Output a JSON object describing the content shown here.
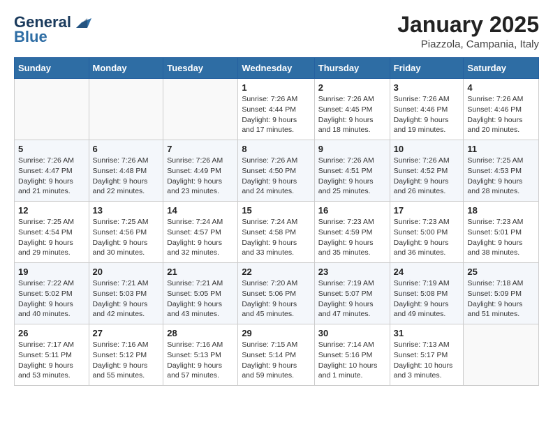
{
  "header": {
    "logo_general": "General",
    "logo_blue": "Blue",
    "title": "January 2025",
    "location": "Piazzola, Campania, Italy"
  },
  "weekdays": [
    "Sunday",
    "Monday",
    "Tuesday",
    "Wednesday",
    "Thursday",
    "Friday",
    "Saturday"
  ],
  "weeks": [
    [
      {
        "day": "",
        "sunrise": "",
        "sunset": "",
        "daylight": ""
      },
      {
        "day": "",
        "sunrise": "",
        "sunset": "",
        "daylight": ""
      },
      {
        "day": "",
        "sunrise": "",
        "sunset": "",
        "daylight": ""
      },
      {
        "day": "1",
        "sunrise": "Sunrise: 7:26 AM",
        "sunset": "Sunset: 4:44 PM",
        "daylight": "Daylight: 9 hours and 17 minutes."
      },
      {
        "day": "2",
        "sunrise": "Sunrise: 7:26 AM",
        "sunset": "Sunset: 4:45 PM",
        "daylight": "Daylight: 9 hours and 18 minutes."
      },
      {
        "day": "3",
        "sunrise": "Sunrise: 7:26 AM",
        "sunset": "Sunset: 4:46 PM",
        "daylight": "Daylight: 9 hours and 19 minutes."
      },
      {
        "day": "4",
        "sunrise": "Sunrise: 7:26 AM",
        "sunset": "Sunset: 4:46 PM",
        "daylight": "Daylight: 9 hours and 20 minutes."
      }
    ],
    [
      {
        "day": "5",
        "sunrise": "Sunrise: 7:26 AM",
        "sunset": "Sunset: 4:47 PM",
        "daylight": "Daylight: 9 hours and 21 minutes."
      },
      {
        "day": "6",
        "sunrise": "Sunrise: 7:26 AM",
        "sunset": "Sunset: 4:48 PM",
        "daylight": "Daylight: 9 hours and 22 minutes."
      },
      {
        "day": "7",
        "sunrise": "Sunrise: 7:26 AM",
        "sunset": "Sunset: 4:49 PM",
        "daylight": "Daylight: 9 hours and 23 minutes."
      },
      {
        "day": "8",
        "sunrise": "Sunrise: 7:26 AM",
        "sunset": "Sunset: 4:50 PM",
        "daylight": "Daylight: 9 hours and 24 minutes."
      },
      {
        "day": "9",
        "sunrise": "Sunrise: 7:26 AM",
        "sunset": "Sunset: 4:51 PM",
        "daylight": "Daylight: 9 hours and 25 minutes."
      },
      {
        "day": "10",
        "sunrise": "Sunrise: 7:26 AM",
        "sunset": "Sunset: 4:52 PM",
        "daylight": "Daylight: 9 hours and 26 minutes."
      },
      {
        "day": "11",
        "sunrise": "Sunrise: 7:25 AM",
        "sunset": "Sunset: 4:53 PM",
        "daylight": "Daylight: 9 hours and 28 minutes."
      }
    ],
    [
      {
        "day": "12",
        "sunrise": "Sunrise: 7:25 AM",
        "sunset": "Sunset: 4:54 PM",
        "daylight": "Daylight: 9 hours and 29 minutes."
      },
      {
        "day": "13",
        "sunrise": "Sunrise: 7:25 AM",
        "sunset": "Sunset: 4:56 PM",
        "daylight": "Daylight: 9 hours and 30 minutes."
      },
      {
        "day": "14",
        "sunrise": "Sunrise: 7:24 AM",
        "sunset": "Sunset: 4:57 PM",
        "daylight": "Daylight: 9 hours and 32 minutes."
      },
      {
        "day": "15",
        "sunrise": "Sunrise: 7:24 AM",
        "sunset": "Sunset: 4:58 PM",
        "daylight": "Daylight: 9 hours and 33 minutes."
      },
      {
        "day": "16",
        "sunrise": "Sunrise: 7:23 AM",
        "sunset": "Sunset: 4:59 PM",
        "daylight": "Daylight: 9 hours and 35 minutes."
      },
      {
        "day": "17",
        "sunrise": "Sunrise: 7:23 AM",
        "sunset": "Sunset: 5:00 PM",
        "daylight": "Daylight: 9 hours and 36 minutes."
      },
      {
        "day": "18",
        "sunrise": "Sunrise: 7:23 AM",
        "sunset": "Sunset: 5:01 PM",
        "daylight": "Daylight: 9 hours and 38 minutes."
      }
    ],
    [
      {
        "day": "19",
        "sunrise": "Sunrise: 7:22 AM",
        "sunset": "Sunset: 5:02 PM",
        "daylight": "Daylight: 9 hours and 40 minutes."
      },
      {
        "day": "20",
        "sunrise": "Sunrise: 7:21 AM",
        "sunset": "Sunset: 5:03 PM",
        "daylight": "Daylight: 9 hours and 42 minutes."
      },
      {
        "day": "21",
        "sunrise": "Sunrise: 7:21 AM",
        "sunset": "Sunset: 5:05 PM",
        "daylight": "Daylight: 9 hours and 43 minutes."
      },
      {
        "day": "22",
        "sunrise": "Sunrise: 7:20 AM",
        "sunset": "Sunset: 5:06 PM",
        "daylight": "Daylight: 9 hours and 45 minutes."
      },
      {
        "day": "23",
        "sunrise": "Sunrise: 7:19 AM",
        "sunset": "Sunset: 5:07 PM",
        "daylight": "Daylight: 9 hours and 47 minutes."
      },
      {
        "day": "24",
        "sunrise": "Sunrise: 7:19 AM",
        "sunset": "Sunset: 5:08 PM",
        "daylight": "Daylight: 9 hours and 49 minutes."
      },
      {
        "day": "25",
        "sunrise": "Sunrise: 7:18 AM",
        "sunset": "Sunset: 5:09 PM",
        "daylight": "Daylight: 9 hours and 51 minutes."
      }
    ],
    [
      {
        "day": "26",
        "sunrise": "Sunrise: 7:17 AM",
        "sunset": "Sunset: 5:11 PM",
        "daylight": "Daylight: 9 hours and 53 minutes."
      },
      {
        "day": "27",
        "sunrise": "Sunrise: 7:16 AM",
        "sunset": "Sunset: 5:12 PM",
        "daylight": "Daylight: 9 hours and 55 minutes."
      },
      {
        "day": "28",
        "sunrise": "Sunrise: 7:16 AM",
        "sunset": "Sunset: 5:13 PM",
        "daylight": "Daylight: 9 hours and 57 minutes."
      },
      {
        "day": "29",
        "sunrise": "Sunrise: 7:15 AM",
        "sunset": "Sunset: 5:14 PM",
        "daylight": "Daylight: 9 hours and 59 minutes."
      },
      {
        "day": "30",
        "sunrise": "Sunrise: 7:14 AM",
        "sunset": "Sunset: 5:16 PM",
        "daylight": "Daylight: 10 hours and 1 minute."
      },
      {
        "day": "31",
        "sunrise": "Sunrise: 7:13 AM",
        "sunset": "Sunset: 5:17 PM",
        "daylight": "Daylight: 10 hours and 3 minutes."
      },
      {
        "day": "",
        "sunrise": "",
        "sunset": "",
        "daylight": ""
      }
    ]
  ]
}
